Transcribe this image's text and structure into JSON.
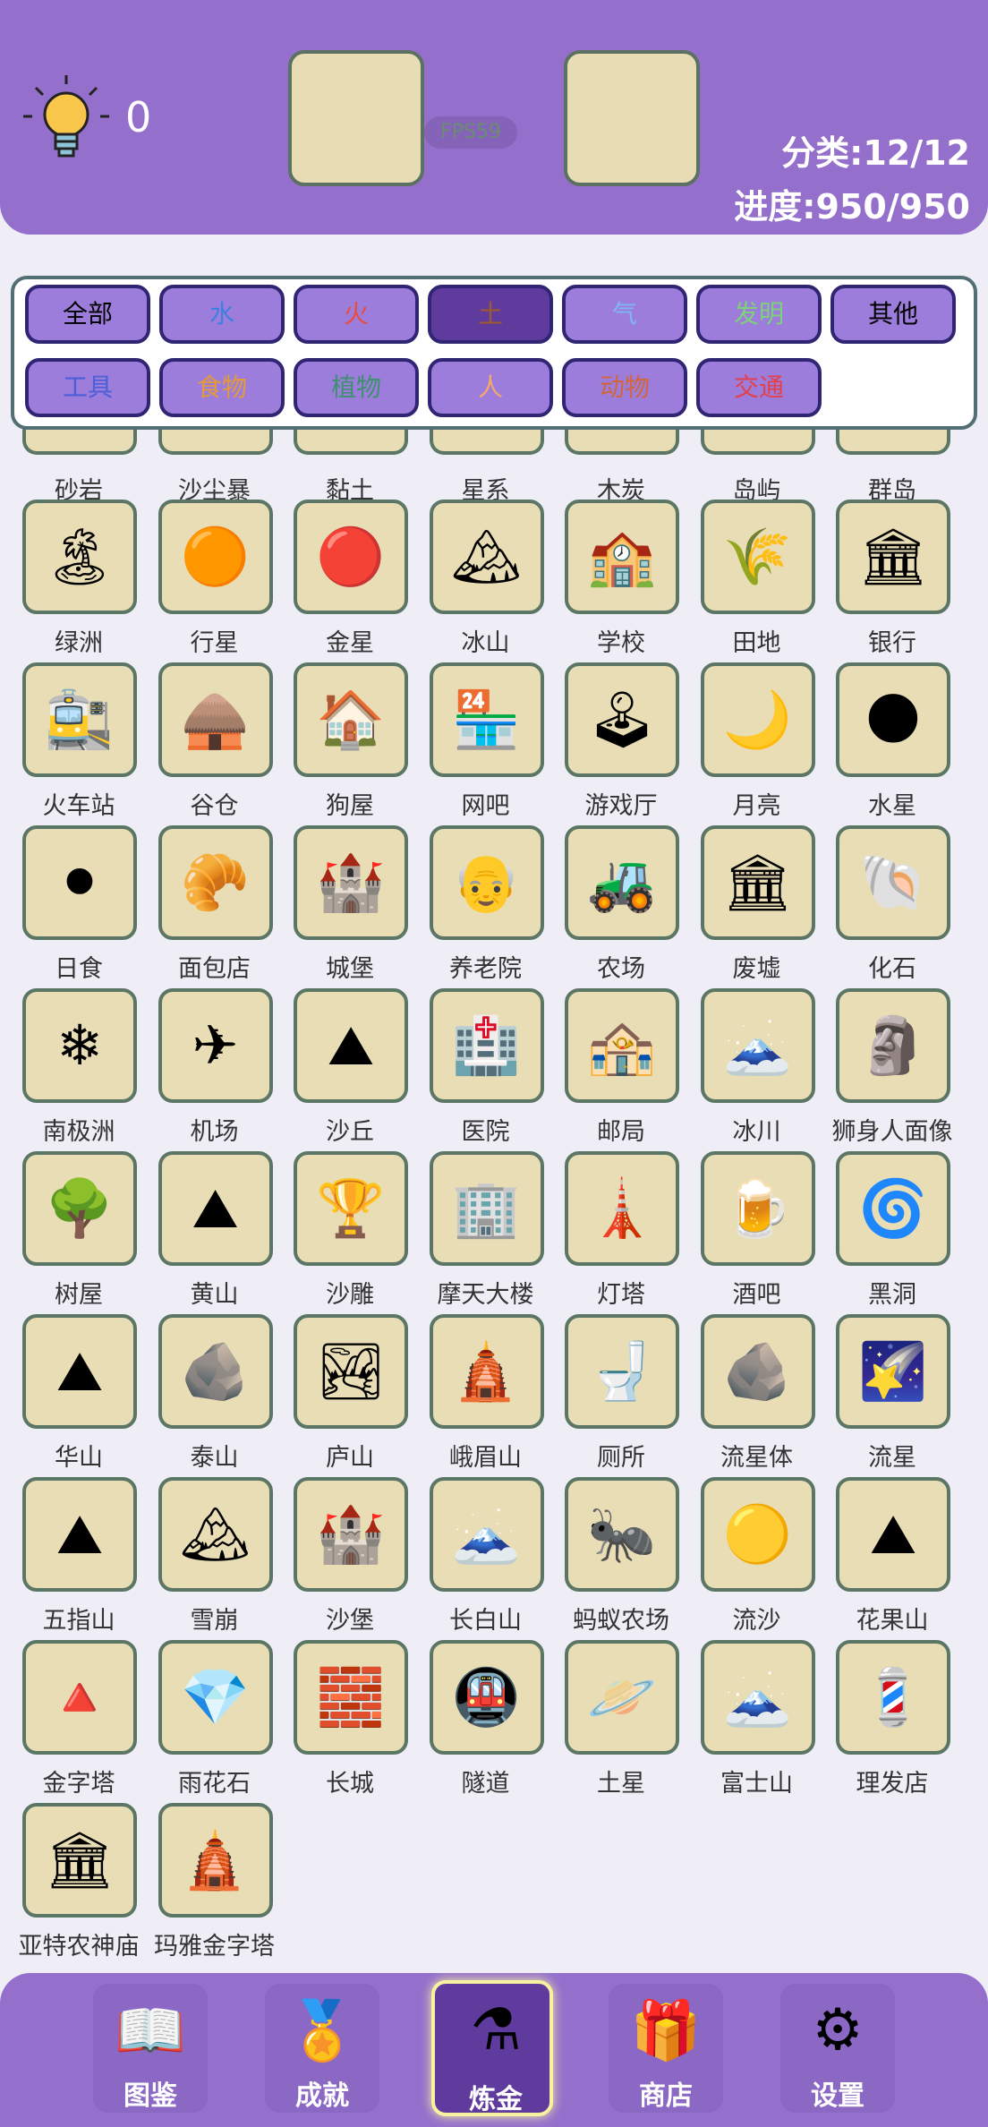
{
  "header": {
    "hint_count": "0",
    "fps": "FPS59",
    "category_progress": "分类:12/12",
    "overall_progress": "进度:950/950"
  },
  "categories": [
    {
      "label": "全部",
      "color": "#000000",
      "active": false
    },
    {
      "label": "水",
      "color": "#3f7fe0",
      "active": false
    },
    {
      "label": "火",
      "color": "#e84d3d",
      "active": false
    },
    {
      "label": "土",
      "color": "#a05a2c",
      "active": true
    },
    {
      "label": "气",
      "color": "#7fb6f0",
      "active": false
    },
    {
      "label": "发明",
      "color": "#7ed07a",
      "active": false
    },
    {
      "label": "其他",
      "color": "#000000",
      "active": false
    },
    {
      "label": "工具",
      "color": "#4a5fd8",
      "active": false
    },
    {
      "label": "食物",
      "color": "#e29b3c",
      "active": false
    },
    {
      "label": "植物",
      "color": "#3e9070",
      "active": false
    },
    {
      "label": "人",
      "color": "#f6a86a",
      "active": false
    },
    {
      "label": "动物",
      "color": "#d2663a",
      "active": false
    },
    {
      "label": "交通",
      "color": "#e5404a",
      "active": false
    }
  ],
  "elements": [
    {
      "name": "砂岩",
      "icon": "sandstone-icon",
      "glyph": ""
    },
    {
      "name": "沙尘暴",
      "icon": "sandstorm-icon",
      "glyph": ""
    },
    {
      "name": "黏土",
      "icon": "clay-icon",
      "glyph": ""
    },
    {
      "name": "星系",
      "icon": "galaxy-icon",
      "glyph": ""
    },
    {
      "name": "木炭",
      "icon": "charcoal-icon",
      "glyph": ""
    },
    {
      "name": "岛屿",
      "icon": "island-icon",
      "glyph": ""
    },
    {
      "name": "群岛",
      "icon": "archipelago-icon",
      "glyph": ""
    },
    {
      "name": "绿洲",
      "icon": "oasis-icon",
      "glyph": "🏝"
    },
    {
      "name": "行星",
      "icon": "planet-icon",
      "glyph": "🟠"
    },
    {
      "name": "金星",
      "icon": "venus-icon",
      "glyph": "🔴"
    },
    {
      "name": "冰山",
      "icon": "iceberg-icon",
      "glyph": "🏔"
    },
    {
      "name": "学校",
      "icon": "school-icon",
      "glyph": "🏫"
    },
    {
      "name": "田地",
      "icon": "field-icon",
      "glyph": "🌾"
    },
    {
      "name": "银行",
      "icon": "bank-icon",
      "glyph": "🏛"
    },
    {
      "name": "火车站",
      "icon": "train-station-icon",
      "glyph": "🚉"
    },
    {
      "name": "谷仓",
      "icon": "barn-icon",
      "glyph": "🛖"
    },
    {
      "name": "狗屋",
      "icon": "doghouse-icon",
      "glyph": "🏠"
    },
    {
      "name": "网吧",
      "icon": "internet-cafe-icon",
      "glyph": "🏪"
    },
    {
      "name": "游戏厅",
      "icon": "arcade-icon",
      "glyph": "🕹"
    },
    {
      "name": "月亮",
      "icon": "moon-icon",
      "glyph": "🌙"
    },
    {
      "name": "水星",
      "icon": "mercury-icon",
      "glyph": "🌑"
    },
    {
      "name": "日食",
      "icon": "eclipse-icon",
      "glyph": "⚫"
    },
    {
      "name": "面包店",
      "icon": "bakery-icon",
      "glyph": "🥐"
    },
    {
      "name": "城堡",
      "icon": "castle-icon",
      "glyph": "🏰"
    },
    {
      "name": "养老院",
      "icon": "nursing-home-icon",
      "glyph": "👴"
    },
    {
      "name": "农场",
      "icon": "farm-icon",
      "glyph": "🚜"
    },
    {
      "name": "废墟",
      "icon": "ruins-icon",
      "glyph": "🏛"
    },
    {
      "name": "化石",
      "icon": "fossil-icon",
      "glyph": "🐚"
    },
    {
      "name": "南极洲",
      "icon": "antarctica-icon",
      "glyph": "❄"
    },
    {
      "name": "机场",
      "icon": "airport-icon",
      "glyph": "✈"
    },
    {
      "name": "沙丘",
      "icon": "dune-icon",
      "glyph": "⛰"
    },
    {
      "name": "医院",
      "icon": "hospital-icon",
      "glyph": "🏥"
    },
    {
      "name": "邮局",
      "icon": "post-office-icon",
      "glyph": "🏤"
    },
    {
      "name": "冰川",
      "icon": "glacier-icon",
      "glyph": "🗻"
    },
    {
      "name": "狮身人面像",
      "icon": "sphinx-icon",
      "glyph": "🗿"
    },
    {
      "name": "树屋",
      "icon": "treehouse-icon",
      "glyph": "🌳"
    },
    {
      "name": "黄山",
      "icon": "huangshan-icon",
      "glyph": "⛰"
    },
    {
      "name": "沙雕",
      "icon": "sand-sculpture-icon",
      "glyph": "🏆"
    },
    {
      "name": "摩天大楼",
      "icon": "skyscraper-icon",
      "glyph": "🏢"
    },
    {
      "name": "灯塔",
      "icon": "lighthouse-icon",
      "glyph": "🗼"
    },
    {
      "name": "酒吧",
      "icon": "bar-icon",
      "glyph": "🍺"
    },
    {
      "name": "黑洞",
      "icon": "black-hole-icon",
      "glyph": "🌀"
    },
    {
      "name": "华山",
      "icon": "huashan-icon",
      "glyph": "⛰"
    },
    {
      "name": "泰山",
      "icon": "taishan-icon",
      "glyph": "🪨"
    },
    {
      "name": "庐山",
      "icon": "lushan-icon",
      "glyph": "🏞"
    },
    {
      "name": "峨眉山",
      "icon": "emeishan-icon",
      "glyph": "🛕"
    },
    {
      "name": "厕所",
      "icon": "toilet-icon",
      "glyph": "🚽"
    },
    {
      "name": "流星体",
      "icon": "meteoroid-icon",
      "glyph": "🪨"
    },
    {
      "name": "流星",
      "icon": "meteor-icon",
      "glyph": "🌠"
    },
    {
      "name": "五指山",
      "icon": "wuzhishan-icon",
      "glyph": "⛰"
    },
    {
      "name": "雪崩",
      "icon": "avalanche-icon",
      "glyph": "🏔"
    },
    {
      "name": "沙堡",
      "icon": "sandcastle-icon",
      "glyph": "🏰"
    },
    {
      "name": "长白山",
      "icon": "changbaishan-icon",
      "glyph": "🗻"
    },
    {
      "name": "蚂蚁农场",
      "icon": "ant-farm-icon",
      "glyph": "🐜"
    },
    {
      "name": "流沙",
      "icon": "quicksand-icon",
      "glyph": "🟡"
    },
    {
      "name": "花果山",
      "icon": "huaguoshan-icon",
      "glyph": "⛰"
    },
    {
      "name": "金字塔",
      "icon": "pyramid-icon",
      "glyph": "🔺"
    },
    {
      "name": "雨花石",
      "icon": "rain-flower-stone-icon",
      "glyph": "💎"
    },
    {
      "name": "长城",
      "icon": "great-wall-icon",
      "glyph": "🧱"
    },
    {
      "name": "隧道",
      "icon": "tunnel-icon",
      "glyph": "🚇"
    },
    {
      "name": "土星",
      "icon": "saturn-icon",
      "glyph": "🪐"
    },
    {
      "name": "富士山",
      "icon": "mount-fuji-icon",
      "glyph": "🗻"
    },
    {
      "name": "理发店",
      "icon": "barbershop-icon",
      "glyph": "💈"
    },
    {
      "name": "亚特农神庙",
      "icon": "parthenon-icon",
      "glyph": "🏛"
    },
    {
      "name": "玛雅金字塔",
      "icon": "mayan-pyramid-icon",
      "glyph": "🛕"
    }
  ],
  "bottom_nav": [
    {
      "label": "图鉴",
      "icon": "encyclopedia-book-icon",
      "glyph": "📖",
      "active": false
    },
    {
      "label": "成就",
      "icon": "achievement-medal-icon",
      "glyph": "🏅",
      "active": false
    },
    {
      "label": "炼金",
      "icon": "alchemy-flask-icon",
      "glyph": "⚗",
      "active": true
    },
    {
      "label": "商店",
      "icon": "shop-gift-icon",
      "glyph": "🎁",
      "active": false
    },
    {
      "label": "设置",
      "icon": "settings-gear-icon",
      "glyph": "⚙",
      "active": false
    }
  ]
}
